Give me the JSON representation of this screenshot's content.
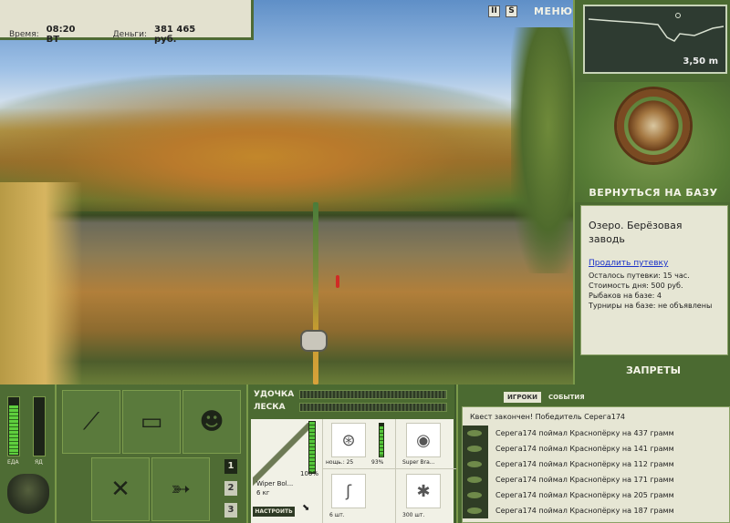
{
  "info": {
    "time_label": "Время:",
    "time_value": "08:20 ВТ",
    "money_label": "Деньги:",
    "money_value": "381 465 руб."
  },
  "top_buttons": {
    "pause_icon": "pause-icon",
    "stop_icon": "s-icon",
    "menu_label": "МЕНЮ"
  },
  "depth": {
    "value": "3,50 m"
  },
  "right_panel": {
    "return_label": "ВЕРНУТЬСЯ НА БАЗУ",
    "bans_label": "ЗАПРЕТЫ",
    "lake": {
      "title": "Озеро. Берёзовая заводь",
      "extend_link": "Продлить путевку",
      "remaining": "Осталось путевки: 15 час.",
      "day_cost": "Стоимость дня: 500 руб.",
      "fishermen": "Рыбаков на базе: 4",
      "tournaments": "Турниры на базе: не объявлены"
    }
  },
  "meters": {
    "food_label": "ЕДА",
    "poison_label": "ЯД",
    "food_level": 0.85,
    "poison_level": 0.0
  },
  "page_buttons": [
    "1",
    "2",
    "3"
  ],
  "tackle": {
    "rod_label": "УДОЧКА",
    "line_label": "ЛЕСКА",
    "rod_name": "Wiper Bol...",
    "rod_weight": "6 кг",
    "rod_condition": "100%",
    "adjust_label": "НАСТРОИТЬ",
    "reel_label": "нощь.: 25",
    "reel_pct": "93%",
    "line_item_label": "Super Bra...",
    "hook_label": "6 шт.",
    "bait_label": "300 шт."
  },
  "events": {
    "tab_players": "ИГРОКИ",
    "tab_events": "СОБЫТИЯ",
    "quest": "Квест закончен! Победитель Серега174",
    "rows": [
      "Серега174 поймал Краснопёрку на 437 грамм",
      "Серега174 поймал Краснопёрку на 141 грамм",
      "Серега174 поймал Краснопёрку на 112 грамм",
      "Серега174 поймал Краснопёрку на 171 грамм",
      "Серега174 поймал Краснопёрку на 205 грамм",
      "Серега174 поймал Краснопёрку на 187 грамм"
    ]
  }
}
